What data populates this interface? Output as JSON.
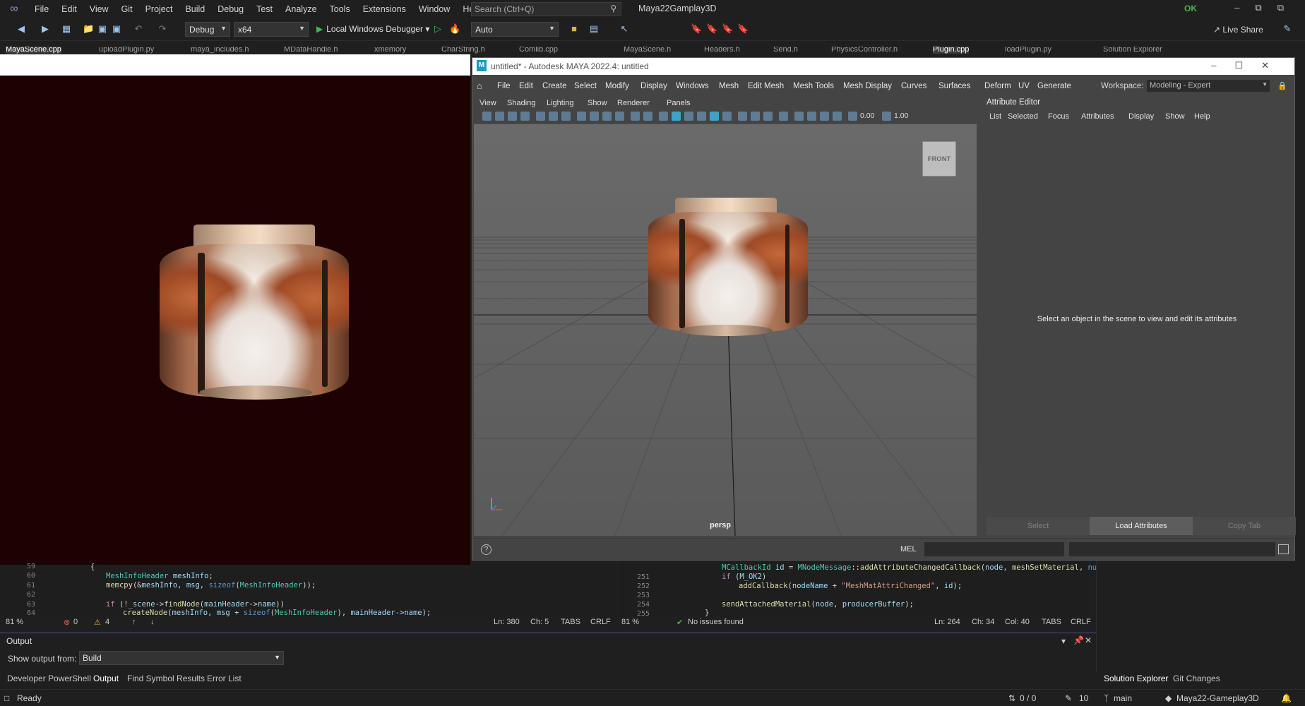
{
  "vs": {
    "menu": [
      "File",
      "Edit",
      "View",
      "Git",
      "Project",
      "Build",
      "Debug",
      "Test",
      "Analyze",
      "Tools",
      "Extensions",
      "Window",
      "Help"
    ],
    "search_placeholder": "Search (Ctrl+Q)",
    "project_name": "Maya22Gamplay3D",
    "ok_badge": "OK",
    "config": "Debug",
    "platform": "x64",
    "debugger": "Local Windows Debugger",
    "auto": "Auto",
    "live_share": "Live Share",
    "tabs": [
      "MayaScene.cpp",
      "uploadPlugin.py",
      "maya_includes.h",
      "MDataHandle.h",
      "xmemory",
      "CharString.h",
      "Comlib.cpp",
      "MayaScene.h",
      "Headers.h",
      "Send.h",
      "PhysicsController.h",
      "Plugin.cpp",
      "loadPlugin.py",
      "Solution Explorer"
    ]
  },
  "maya": {
    "title": "untitled* - Autodesk MAYA 2022.4: untitled",
    "menu": [
      "File",
      "Edit",
      "Create",
      "Select",
      "Modify",
      "Display",
      "Windows",
      "Mesh",
      "Edit Mesh",
      "Mesh Tools",
      "Mesh Display",
      "Curves",
      "Surfaces",
      "Deform",
      "UV",
      "Generate"
    ],
    "workspace_label": "Workspace:",
    "workspace_value": "Modeling - Expert",
    "viewport_menu": [
      "View",
      "Shading",
      "Lighting",
      "Show",
      "Renderer",
      "Panels"
    ],
    "field_a": "0.00",
    "field_b": "1.00",
    "viewcube_label": "FRONT",
    "camera_label": "persp",
    "attr_title": "Attribute Editor",
    "attr_menu": [
      "List",
      "Selected",
      "Focus",
      "Attributes",
      "Display",
      "Show",
      "Help"
    ],
    "attr_message": "Select an object in the scene to view and edit its attributes",
    "attr_buttons": [
      "Select",
      "Load Attributes",
      "Copy Tab"
    ],
    "mel_label": "MEL"
  },
  "code_left": {
    "lines": [
      "59",
      "60",
      "61",
      "62",
      "63",
      "64"
    ],
    "zoom": "81 %",
    "errors": "0",
    "warnings": "4",
    "ln": "Ln: 380",
    "ch": "Ch: 5",
    "tabs": "TABS",
    "eol": "CRLF"
  },
  "code_right": {
    "lines": [
      "251",
      "252",
      "253",
      "254",
      "255"
    ],
    "zoom": "81 %",
    "issues": "No issues found",
    "ln": "Ln: 264",
    "ch": "Ch: 34",
    "col": "Col: 40",
    "tabs": "TABS",
    "eol": "CRLF"
  },
  "output": {
    "title": "Output",
    "source_label": "Show output from:",
    "source_value": "Build"
  },
  "bottom_tabs": [
    "Developer PowerShell",
    "Output",
    "Find Symbol Results",
    "Error List",
    "Solution Explorer",
    "Git Changes"
  ],
  "status": {
    "ready": "Ready",
    "changes": "0 / 0",
    "pencil": "10",
    "branch": "main",
    "repo": "Maya22-Gameplay3D"
  }
}
